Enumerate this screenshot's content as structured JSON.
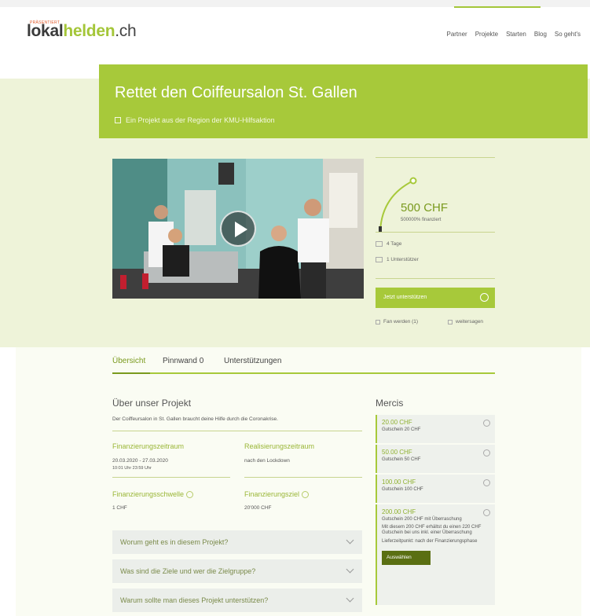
{
  "header": {
    "logo_tag": "präsentiert",
    "logo_part1": "lokal",
    "logo_part2": "helden",
    "logo_domain": ".ch",
    "nav": [
      "Partner",
      "Projekte",
      "Starten",
      "Blog",
      "So geht's"
    ]
  },
  "banner": {
    "title": "Rettet den Coiffeursalon St. Gallen",
    "subtitle": "Ein Projekt aus der Region der KMU-Hilfsaktion"
  },
  "stats": {
    "amount": "500 CHF",
    "financed": "500000% finanziert",
    "days": "4 Tage",
    "supporters": "1 Unterstützer",
    "support_button": "Jetzt unterstützen",
    "fan": "Fan werden (1)",
    "share": "weitersagen",
    "funded_fraction": 1.0
  },
  "tabs": [
    "Übersicht",
    "Pinnwand 0",
    "Unterstützungen"
  ],
  "about": {
    "title": "Über unser Projekt",
    "text": "Der Coiffeursalon in St. Gallen braucht deine Hilfe durch die Coronakrise.",
    "funding_period_label": "Finanzierungszeitraum",
    "funding_period_value_dates": "20.03.2020  -  27.03.2020",
    "funding_period_value_times": "10:01 Uhr         23:59 Uhr",
    "realization_label": "Realisierungszeitraum",
    "realization_value": "nach den Lockdown",
    "threshold_label": "Finanzierungsschwelle",
    "threshold_value": "1 CHF",
    "goal_label": "Finanzierungsziel",
    "goal_value": "20'000 CHF"
  },
  "accordion": [
    "Worum geht es in diesem Projekt?",
    "Was sind die Ziele und wer die Zielgruppe?",
    "Warum sollte man dieses Projekt unterstützen?"
  ],
  "mercis": {
    "title": "Mercis",
    "items": [
      {
        "price": "20.00 CHF",
        "desc": "Gutschein 20 CHF"
      },
      {
        "price": "50.00 CHF",
        "desc": "Gutschein 50 CHF"
      },
      {
        "price": "100.00 CHF",
        "desc": "Gutschein 100 CHF"
      },
      {
        "price": "200.00 CHF",
        "desc": "Gutschein 200 CHF mit Überraschung",
        "more1": "Mit diesem 200 CHF erhältst du einen 220 CHF Gutschein bei uns inkl. einer Überraschung",
        "more2": "Lieferzeitpunkt: nach der Finanzierungsphase",
        "button": "Auswählen"
      }
    ]
  },
  "colors": {
    "accent": "#a7c93a",
    "accent_dark": "#7a9a1e",
    "hero_bg": "#eef3d9"
  }
}
